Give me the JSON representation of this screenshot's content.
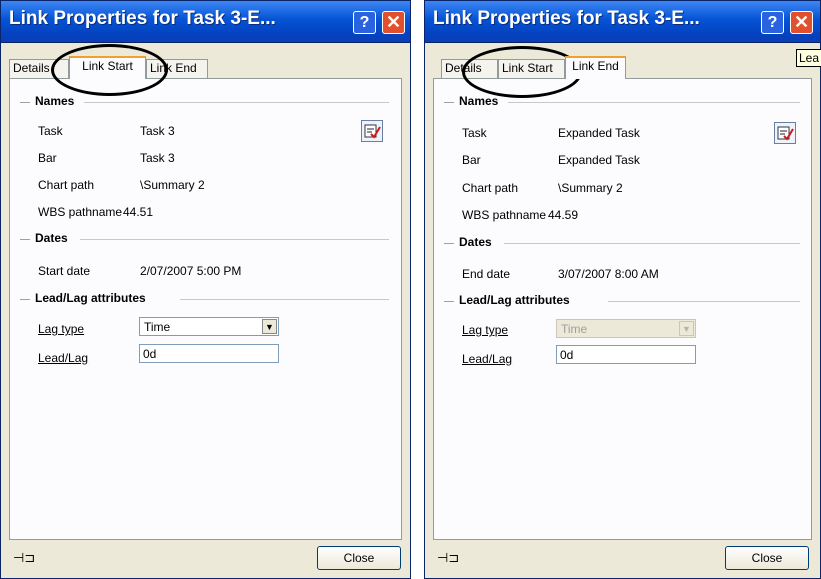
{
  "windows": [
    {
      "title": "Link Properties for Task 3-E...",
      "help_label": "?",
      "close_x": "✕",
      "tabs": [
        "Details",
        "Link Start",
        "Link End"
      ],
      "active_tab": "Link Start",
      "sections": {
        "names": "Names",
        "dates": "Dates",
        "leadlag": "Lead/Lag attributes"
      },
      "fields": {
        "task_label": "Task",
        "task_value": "Task 3",
        "bar_label": "Bar",
        "bar_value": "Task 3",
        "chart_path_label": "Chart path",
        "chart_path_value": "\\Summary 2",
        "wbs_label": "WBS pathname",
        "wbs_value": "44.51",
        "date_label": "Start date",
        "date_value": "2/07/2007 5:00 PM",
        "lag_type_label": "Lag type",
        "lag_type_value": "Time",
        "leadlag_label": "Lead/Lag",
        "leadlag_value": "0d"
      },
      "close_button": "Close"
    },
    {
      "title": "Link Properties for Task 3-E...",
      "help_label": "?",
      "close_x": "✕",
      "tabs": [
        "Details",
        "Link Start",
        "Link End"
      ],
      "active_tab": "Link End",
      "sections": {
        "names": "Names",
        "dates": "Dates",
        "leadlag": "Lead/Lag attributes"
      },
      "fields": {
        "task_label": "Task",
        "task_value": "Expanded Task",
        "bar_label": "Bar",
        "bar_value": "Expanded Task",
        "chart_path_label": "Chart path",
        "chart_path_value": "\\Summary 2",
        "wbs_label": "WBS pathname",
        "wbs_value": "44.59",
        "date_label": "End date",
        "date_value": "3/07/2007 8:00 AM",
        "lag_type_label": "Lag type",
        "lag_type_value": "Time",
        "leadlag_label": "Lead/Lag",
        "leadlag_value": "0d"
      },
      "close_button": "Close"
    }
  ],
  "tooltip_fragment": "Lea",
  "colors": {
    "title_bar": "#0553d5",
    "close_button": "#e1502d",
    "dialog_bg": "#ece9d8",
    "tab_highlight": "#f0a030"
  }
}
